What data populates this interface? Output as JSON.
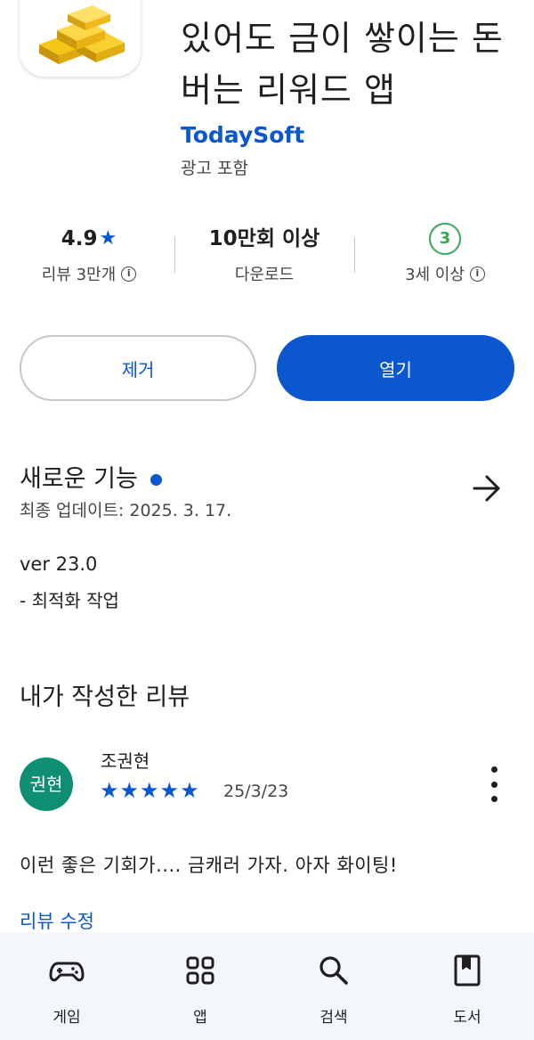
{
  "app": {
    "icon_name": "gold-bars-icon",
    "title": "있어도 금이 쌓이는 돈버는 리워드 앱",
    "developer": "TodaySoft",
    "ad_label": "광고 포함"
  },
  "stats": {
    "rating": "4.9",
    "rating_star": "★",
    "reviews": "리뷰 3만개",
    "downloads": "10만회 이상",
    "downloads_label": "다운로드",
    "age_badge": "3",
    "age_label": "3세 이상"
  },
  "buttons": {
    "remove": "제거",
    "open": "열기"
  },
  "whats_new": {
    "title": "새로운 기능",
    "last_updated": "최종 업데이트: 2025. 3. 17.",
    "version": "ver 23.0",
    "notes": "- 최적화 작업"
  },
  "my_review": {
    "title": "내가 작성한 리뷰",
    "avatar_text": "권현",
    "reviewer": "조권현",
    "rating": 5,
    "stars": "★★★★★",
    "date": "25/3/23",
    "text": "이런 좋은 기회가.... 금캐러 가자. 아자 화이팅!",
    "edit_label": "리뷰 수정"
  },
  "nav": [
    {
      "label": "게임",
      "icon": "gamepad-icon"
    },
    {
      "label": "앱",
      "icon": "apps-grid-icon"
    },
    {
      "label": "검색",
      "icon": "search-icon"
    },
    {
      "label": "도서",
      "icon": "book-icon"
    }
  ],
  "colors": {
    "accent": "#0b57d0",
    "age_green": "#34a853",
    "avatar": "#0e8f74",
    "nav_bg": "#f3f6fb"
  }
}
